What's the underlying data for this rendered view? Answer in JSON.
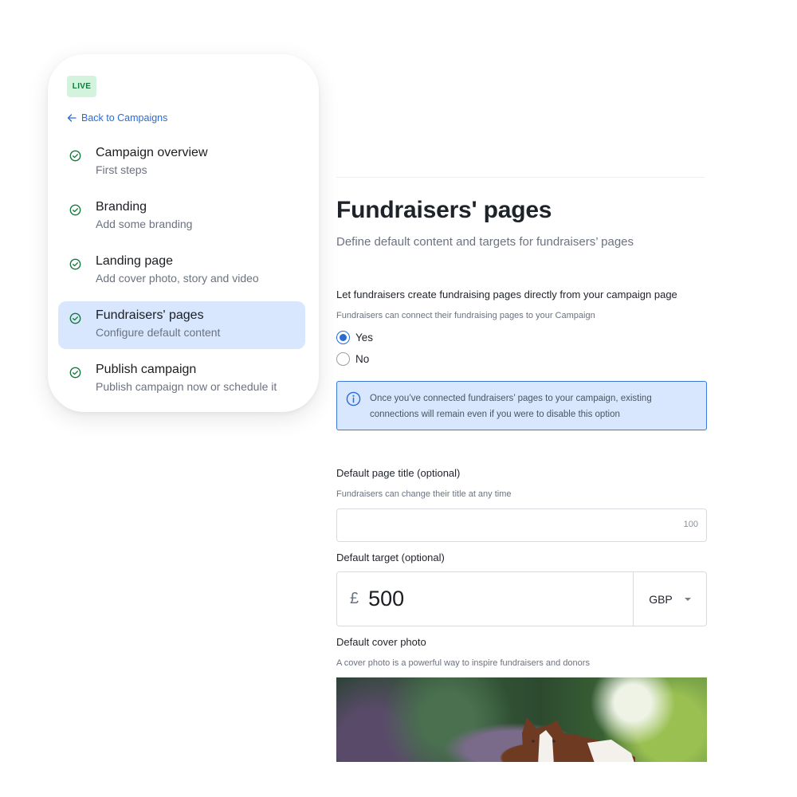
{
  "sidebar": {
    "status_badge": "LIVE",
    "back_link": "Back to Campaigns",
    "items": [
      {
        "title": "Campaign overview",
        "subtitle": "First steps",
        "completed": true,
        "active": false
      },
      {
        "title": "Branding",
        "subtitle": "Add some branding",
        "completed": true,
        "active": false
      },
      {
        "title": "Landing page",
        "subtitle": "Add cover photo, story and video",
        "completed": true,
        "active": false
      },
      {
        "title": "Fundraisers' pages",
        "subtitle": "Configure default content",
        "completed": true,
        "active": true
      },
      {
        "title": "Publish campaign",
        "subtitle": "Publish campaign now or schedule it",
        "completed": true,
        "active": false
      }
    ]
  },
  "main": {
    "title": "Fundraisers' pages",
    "subtitle": "Define default content and targets for fundraisers’ pages",
    "allow_pages": {
      "label": "Let fundraisers create fundraising pages directly from your campaign page",
      "help": "Fundraisers can connect their fundraising pages to your Campaign",
      "options": [
        {
          "label": "Yes",
          "selected": true
        },
        {
          "label": "No",
          "selected": false
        }
      ],
      "info": "Once you’ve connected fundraisers’ pages to your campaign, existing connections will remain even if you were to disable this option"
    },
    "page_title": {
      "label": "Default page title (optional)",
      "help": "Fundraisers can change their title at any time",
      "value": "",
      "char_limit": "100"
    },
    "target": {
      "label": "Default target (optional)",
      "currency_symbol": "£",
      "value": "500",
      "currency": "GBP"
    },
    "cover_photo": {
      "label": "Default cover photo",
      "help": "A cover photo is a powerful way to inspire fundraisers and donors",
      "image_description": "Brown and white dog in a green garden"
    }
  },
  "colors": {
    "accent": "#2a6bd4",
    "success": "#137a3c",
    "badge_bg": "#d4f3df",
    "active_bg": "#d8e7fd"
  }
}
